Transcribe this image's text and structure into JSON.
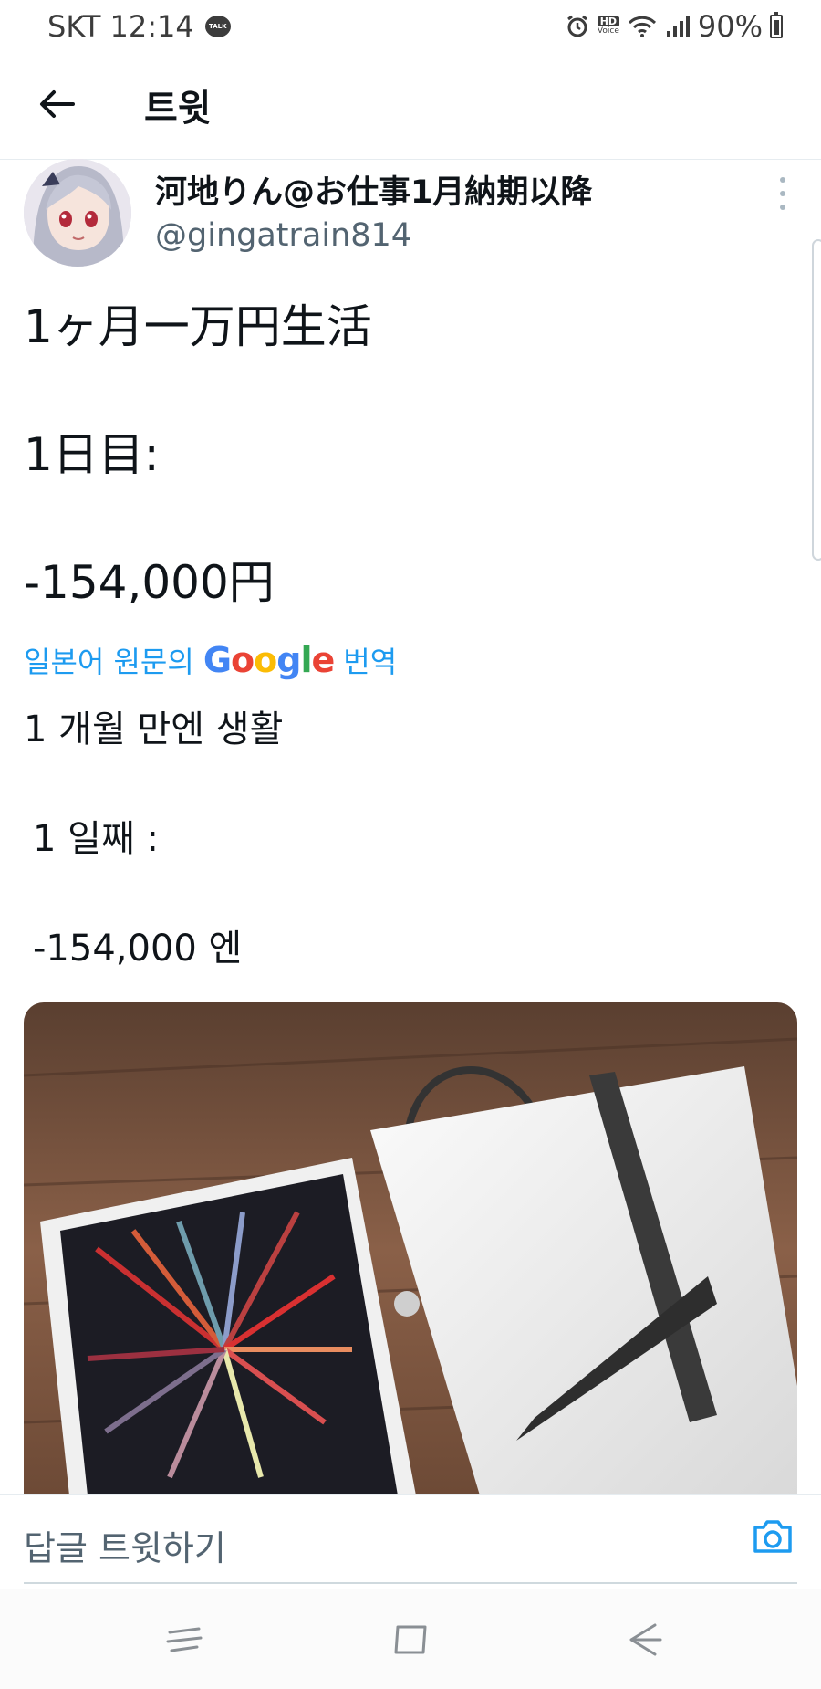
{
  "status_bar": {
    "carrier_time": "SKT 12:14",
    "talk_badge": "TALK",
    "hd_label_top": "HD",
    "hd_label_bottom": "Voice",
    "battery": "90%"
  },
  "header": {
    "title": "트윗"
  },
  "tweet": {
    "display_name": "河地りん@お仕事1月納期以降",
    "handle": "@gingatrain814",
    "lines": [
      "1ヶ月一万円生活",
      "1日目:",
      "-154,000円"
    ],
    "translate": {
      "prefix": "일본어 원문의",
      "google_letters": [
        "G",
        "o",
        "o",
        "g",
        "l",
        "e"
      ],
      "suffix": "번역"
    },
    "translated_lines": [
      "1 개월 만엔 생활",
      "1 일째 :",
      "-154,000 엔"
    ],
    "image_icon": "ipad-and-keyboard-photo"
  },
  "reply_bar": {
    "placeholder": "답글 트윗하기",
    "camera_icon": "camera-icon"
  },
  "nav_bar": {
    "icons": [
      "recent-apps-icon",
      "home-icon",
      "back-icon"
    ]
  },
  "colors": {
    "accent": "#1d9bf0",
    "text": "#0f1419",
    "secondary_text": "#536471"
  }
}
